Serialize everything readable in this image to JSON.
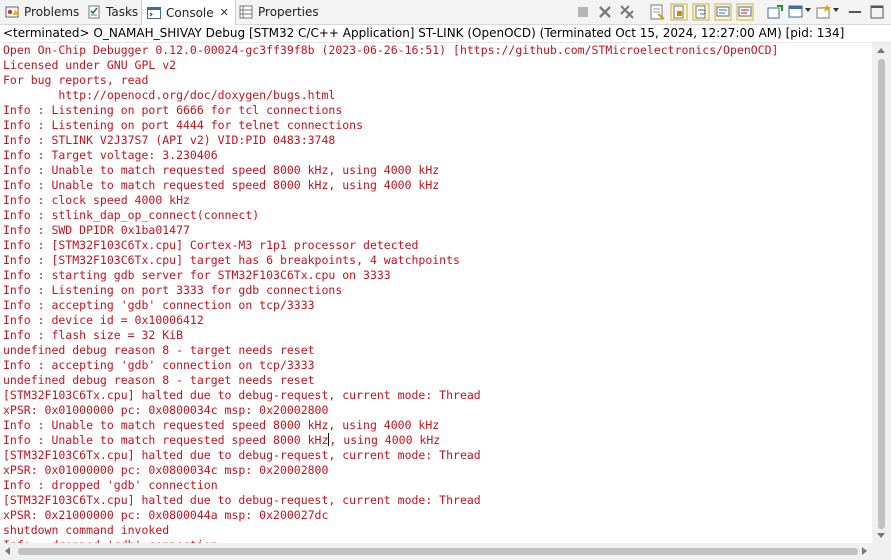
{
  "tabs": [
    {
      "label": "Problems",
      "icon": "problems-icon"
    },
    {
      "label": "Tasks",
      "icon": "tasks-icon"
    },
    {
      "label": "Console",
      "icon": "console-icon",
      "active": true,
      "close": "✕"
    },
    {
      "label": "Properties",
      "icon": "properties-icon"
    }
  ],
  "toolbar_icons": [
    "terminate-icon",
    "remove-launch-icon",
    "remove-all-terminated-icon",
    "clear-console-icon",
    "scroll-lock-icon",
    "word-wrap-icon",
    "show-on-stdout-change-icon",
    "show-on-stderr-change-icon",
    "pin-console-icon",
    "display-selected-console-icon",
    "open-console-icon"
  ],
  "description": "<terminated> O_NAMAH_SHIVAY Debug [STM32 C/C++ Application] ST-LINK (OpenOCD) (Terminated Oct 15, 2024, 12:27:00 AM) [pid: 134]",
  "console_lines": [
    "Open On-Chip Debugger 0.12.0-00024-gc3ff39f8b (2023-06-26-16:51) [https://github.com/STMicroelectronics/OpenOCD]",
    "Licensed under GNU GPL v2",
    "For bug reports, read",
    "        http://openocd.org/doc/doxygen/bugs.html",
    "Info : Listening on port 6666 for tcl connections",
    "Info : Listening on port 4444 for telnet connections",
    "Info : STLINK V2J37S7 (API v2) VID:PID 0483:3748",
    "Info : Target voltage: 3.230406",
    "Info : Unable to match requested speed 8000 kHz, using 4000 kHz",
    "Info : Unable to match requested speed 8000 kHz, using 4000 kHz",
    "Info : clock speed 4000 kHz",
    "Info : stlink_dap_op_connect(connect)",
    "Info : SWD DPIDR 0x1ba01477",
    "Info : [STM32F103C6Tx.cpu] Cortex-M3 r1p1 processor detected",
    "Info : [STM32F103C6Tx.cpu] target has 6 breakpoints, 4 watchpoints",
    "Info : starting gdb server for STM32F103C6Tx.cpu on 3333",
    "Info : Listening on port 3333 for gdb connections",
    "Info : accepting 'gdb' connection on tcp/3333",
    "Info : device id = 0x10006412",
    "Info : flash size = 32 KiB",
    "undefined debug reason 8 - target needs reset",
    "Info : accepting 'gdb' connection on tcp/3333",
    "undefined debug reason 8 - target needs reset",
    "[STM32F103C6Tx.cpu] halted due to debug-request, current mode: Thread",
    "xPSR: 0x01000000 pc: 0x0800034c msp: 0x20002800",
    "Info : Unable to match requested speed 8000 kHz, using 4000 kHz",
    "Info : Unable to match requested speed 8000 kHz, using 4000 kHz",
    "[STM32F103C6Tx.cpu] halted due to debug-request, current mode: Thread",
    "xPSR: 0x01000000 pc: 0x0800034c msp: 0x20002800",
    "Info : dropped 'gdb' connection",
    "[STM32F103C6Tx.cpu] halted due to debug-request, current mode: Thread",
    "xPSR: 0x21000000 pc: 0x0800044a msp: 0x200027dc",
    "shutdown command invoked",
    "Info : dropped 'gdb' connection"
  ],
  "colors": {
    "console_text": "#c8111b",
    "tab_bar": "#f3f3f3"
  }
}
